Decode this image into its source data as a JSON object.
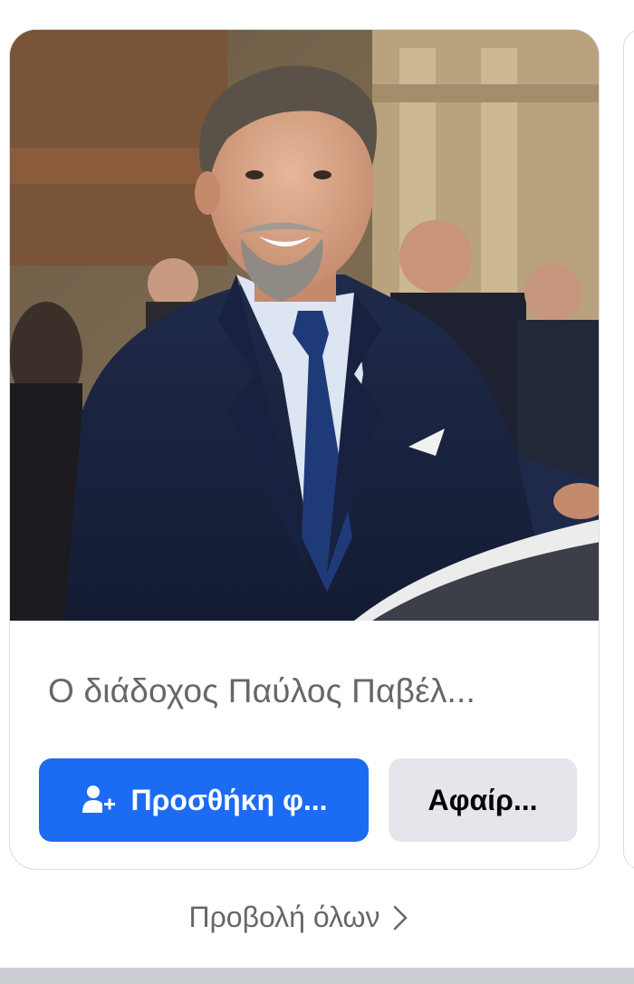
{
  "suggestion_card": {
    "name": "Ο διάδοχος Παύλος Παβέλ...",
    "add_friend_label": "Προσθήκη φ...",
    "remove_label": "Αφαίρ...",
    "add_friend_icon": "add-person-icon"
  },
  "footer": {
    "view_all_label": "Προβολή όλων",
    "view_all_icon": "chevron-right-icon"
  },
  "colors": {
    "primary_button": "#1b6cf2",
    "secondary_button": "#e4e6eb",
    "muted_text": "#65676b",
    "section_divider": "#c9ccd1"
  }
}
